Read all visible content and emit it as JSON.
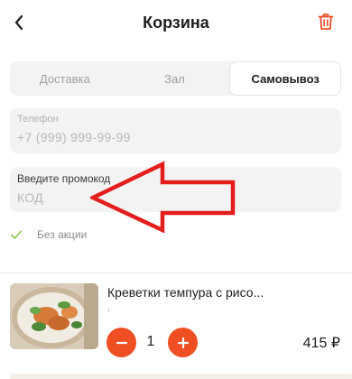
{
  "header": {
    "title": "Корзина"
  },
  "tabs": [
    {
      "label": "Доставка",
      "active": false
    },
    {
      "label": "Зал",
      "active": false
    },
    {
      "label": "Самовывоз",
      "active": true
    }
  ],
  "phone_field": {
    "label": "Телефон",
    "placeholder": "+7 (999) 999-99-99"
  },
  "promo_field": {
    "label": "Введите промокод",
    "placeholder": "КОД"
  },
  "no_promo": {
    "label": "Без акции"
  },
  "cart_item": {
    "name": "Креветки темпура с рисо...",
    "subtitle": ",",
    "quantity": "1",
    "price": "415 ₽"
  },
  "colors": {
    "accent": "#f04e23",
    "arrow": "#e41d1d",
    "field_bg": "#f3f3f3",
    "check": "#8bc34a"
  },
  "icons": {
    "back": "chevron-left-icon",
    "trash": "trash-icon",
    "check": "check-icon",
    "minus": "minus-icon",
    "plus": "plus-icon"
  }
}
